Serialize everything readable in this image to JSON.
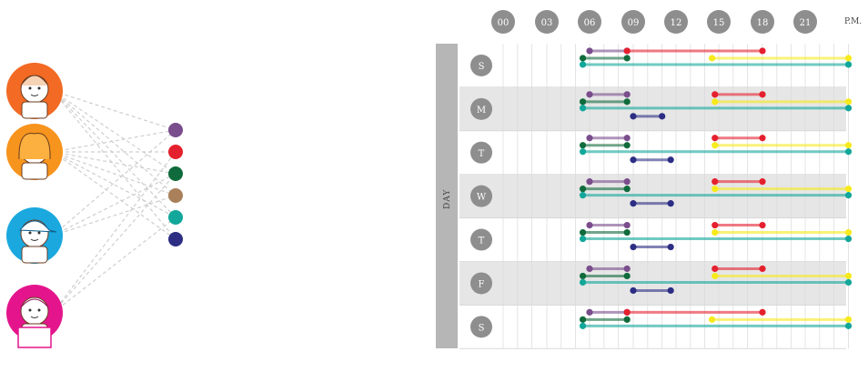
{
  "hour_labels": [
    "00",
    "03",
    "06",
    "09",
    "12",
    "15",
    "18",
    "21"
  ],
  "pm_label": "P.M.",
  "day_axis_label": "DAY",
  "days": [
    "S",
    "M",
    "T",
    "W",
    "T",
    "F",
    "S"
  ],
  "colors": {
    "purple": "#7a4d8c",
    "red": "#e5202e",
    "green": "#106b3c",
    "brown": "#a9805a",
    "teal": "#12a79a",
    "navy": "#2c2d83",
    "yellow": "#f7ea1c",
    "gray_circle": "#8e8e8e",
    "band": "#e6e6e6",
    "sidebar": "#b6b6b6"
  },
  "people": [
    {
      "name": "grandmother-avatar",
      "bg": "#f26a24"
    },
    {
      "name": "woman-avatar",
      "bg": "#f7941d"
    },
    {
      "name": "boy-avatar",
      "bg": "#1ba8df"
    },
    {
      "name": "girl-laptop-avatar",
      "bg": "#e4158c"
    }
  ],
  "legend_dots": [
    "purple",
    "red",
    "green",
    "brown",
    "teal",
    "navy"
  ],
  "chart_data": {
    "type": "timeline",
    "x_unit": "hour",
    "x_range": [
      0,
      24
    ],
    "rows": [
      {
        "day": "S",
        "segments": [
          {
            "color": "purple",
            "start": 6,
            "end": 8.6,
            "lane": 0
          },
          {
            "color": "red",
            "start": 8.6,
            "end": 18,
            "lane": 0
          },
          {
            "color": "yellow",
            "start": 14.5,
            "end": 24,
            "lane": 1
          },
          {
            "color": "green",
            "start": 5.5,
            "end": 8.6,
            "lane": 1
          },
          {
            "color": "teal",
            "start": 5.5,
            "end": 24,
            "lane": 2
          }
        ]
      },
      {
        "day": "M",
        "segments": [
          {
            "color": "purple",
            "start": 6,
            "end": 8.6,
            "lane": 0
          },
          {
            "color": "red",
            "start": 14.7,
            "end": 18,
            "lane": 0
          },
          {
            "color": "yellow",
            "start": 14.7,
            "end": 24,
            "lane": 1
          },
          {
            "color": "green",
            "start": 5.5,
            "end": 8.6,
            "lane": 1
          },
          {
            "color": "teal",
            "start": 5.5,
            "end": 24,
            "lane": 2
          },
          {
            "color": "navy",
            "start": 9,
            "end": 11,
            "lane": 3
          }
        ]
      },
      {
        "day": "T",
        "segments": [
          {
            "color": "purple",
            "start": 6,
            "end": 8.6,
            "lane": 0
          },
          {
            "color": "red",
            "start": 14.7,
            "end": 18,
            "lane": 0
          },
          {
            "color": "yellow",
            "start": 14.7,
            "end": 24,
            "lane": 1
          },
          {
            "color": "green",
            "start": 5.5,
            "end": 8.6,
            "lane": 1
          },
          {
            "color": "teal",
            "start": 5.5,
            "end": 24,
            "lane": 2
          },
          {
            "color": "navy",
            "start": 9,
            "end": 11.6,
            "lane": 3
          }
        ]
      },
      {
        "day": "W",
        "segments": [
          {
            "color": "purple",
            "start": 6,
            "end": 8.6,
            "lane": 0
          },
          {
            "color": "red",
            "start": 14.7,
            "end": 18,
            "lane": 0
          },
          {
            "color": "yellow",
            "start": 14.7,
            "end": 24,
            "lane": 1
          },
          {
            "color": "green",
            "start": 5.5,
            "end": 8.6,
            "lane": 1
          },
          {
            "color": "teal",
            "start": 5.5,
            "end": 24,
            "lane": 2
          },
          {
            "color": "navy",
            "start": 9,
            "end": 11.6,
            "lane": 3
          }
        ]
      },
      {
        "day": "T",
        "segments": [
          {
            "color": "purple",
            "start": 6,
            "end": 8.6,
            "lane": 0
          },
          {
            "color": "red",
            "start": 14.7,
            "end": 18,
            "lane": 0
          },
          {
            "color": "yellow",
            "start": 14.7,
            "end": 24,
            "lane": 1
          },
          {
            "color": "green",
            "start": 5.5,
            "end": 8.6,
            "lane": 1
          },
          {
            "color": "teal",
            "start": 5.5,
            "end": 24,
            "lane": 2
          },
          {
            "color": "navy",
            "start": 9,
            "end": 11.6,
            "lane": 3
          }
        ]
      },
      {
        "day": "F",
        "segments": [
          {
            "color": "purple",
            "start": 6,
            "end": 8.6,
            "lane": 0
          },
          {
            "color": "red",
            "start": 14.7,
            "end": 18,
            "lane": 0
          },
          {
            "color": "yellow",
            "start": 14.7,
            "end": 24,
            "lane": 1
          },
          {
            "color": "green",
            "start": 5.5,
            "end": 8.6,
            "lane": 1
          },
          {
            "color": "teal",
            "start": 5.5,
            "end": 24,
            "lane": 2
          },
          {
            "color": "navy",
            "start": 9,
            "end": 11.6,
            "lane": 3
          }
        ]
      },
      {
        "day": "S",
        "segments": [
          {
            "color": "purple",
            "start": 6,
            "end": 8.6,
            "lane": 0
          },
          {
            "color": "red",
            "start": 8.6,
            "end": 18,
            "lane": 0
          },
          {
            "color": "yellow",
            "start": 14.5,
            "end": 24,
            "lane": 1
          },
          {
            "color": "green",
            "start": 5.5,
            "end": 8.6,
            "lane": 1
          },
          {
            "color": "teal",
            "start": 5.5,
            "end": 24,
            "lane": 2
          }
        ]
      }
    ]
  }
}
